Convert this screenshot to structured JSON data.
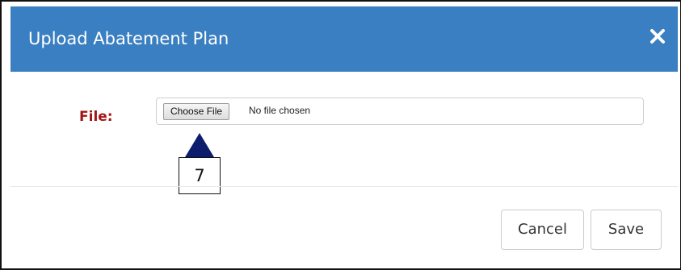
{
  "modal": {
    "title": "Upload Abatement Plan",
    "close_icon": "close-icon",
    "header_color": "#3a7fc1"
  },
  "form": {
    "file_label": "File:",
    "label_color": "#a31515",
    "choose_file_label": "Choose File",
    "no_file_text": "No file chosen"
  },
  "callout": {
    "number": "7",
    "arrow_color": "#0c1d6e"
  },
  "footer": {
    "cancel_label": "Cancel",
    "save_label": "Save"
  }
}
